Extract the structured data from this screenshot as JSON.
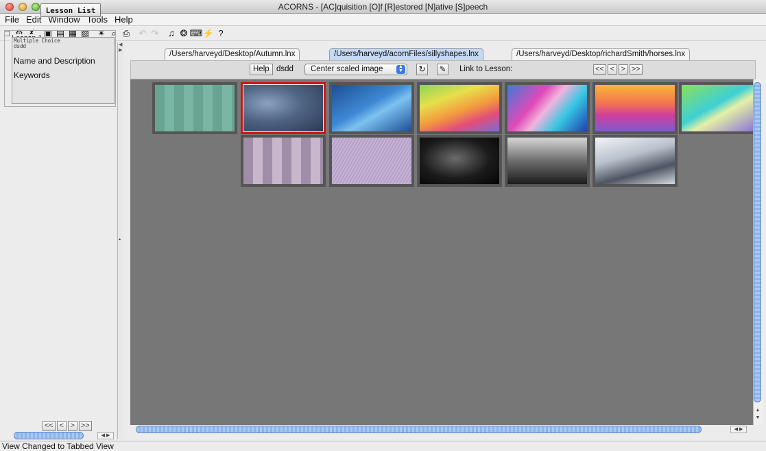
{
  "window": {
    "title": "ACORNS - [AC]quisition [O]f [R]estored [N]ative [S]peech"
  },
  "menu": [
    "File",
    "Edit",
    "Window",
    "Tools",
    "Help"
  ],
  "toolbar": [
    {
      "icon": "new-page-icon",
      "glyph": "□"
    },
    {
      "icon": "open-icon",
      "glyph": "⚙"
    },
    {
      "icon": "cut-icon",
      "glyph": "✗"
    },
    {
      "icon": "save-icon",
      "glyph": "▣"
    },
    {
      "icon": "import-icon",
      "glyph": "▤"
    },
    {
      "icon": "book-icon",
      "glyph": "▦"
    },
    {
      "icon": "book-edit-icon",
      "glyph": "▧"
    },
    {
      "icon": "sparkle-icon",
      "glyph": "✴"
    },
    {
      "icon": "magnify-icon",
      "glyph": "⌕"
    },
    {
      "icon": "print-icon",
      "glyph": "⎙"
    },
    {
      "icon": "undo-icon",
      "glyph": "↶",
      "dim": true
    },
    {
      "icon": "redo-icon",
      "glyph": "↷",
      "dim": true
    },
    {
      "icon": "speaker-icon",
      "glyph": "♫"
    },
    {
      "icon": "lightbulb-icon",
      "glyph": "❂"
    },
    {
      "icon": "keyboard-icon",
      "glyph": "⌨"
    },
    {
      "icon": "lightning-icon",
      "glyph": "⚡"
    },
    {
      "icon": "help-icon",
      "glyph": "?"
    }
  ],
  "left_panel": {
    "lesson_list_label": "Lesson List",
    "lesson_title": "Lesson 1",
    "lesson_type_line1": "Multiple Choice",
    "lesson_type_line2": "dsdd",
    "name_description": "Name and Description",
    "keywords": "Keywords",
    "nav": [
      "<<",
      "<",
      ">",
      ">>"
    ]
  },
  "tabs": [
    {
      "label": "/Users/harveyd/Desktop/Autumn.lnx",
      "active": false
    },
    {
      "label": "/Users/harveyd/acornFiles/sillyshapes.lnx",
      "active": true
    },
    {
      "label": "/Users/harveyd/Desktop/richardSmith/horses.lnx",
      "active": false
    }
  ],
  "content_header": {
    "help_label": "Help",
    "lesson_name": "dsdd",
    "scale_option": "Center scaled image",
    "link_label": "Link to Lesson:",
    "nav": [
      "<<",
      "<",
      ">",
      ">>"
    ]
  },
  "thumbnails": [
    {
      "name": "teal-squares",
      "selected": false
    },
    {
      "name": "blue-gray-swirl",
      "selected": true
    },
    {
      "name": "blue-wave",
      "selected": false
    },
    {
      "name": "rainbow-diagonal",
      "selected": false
    },
    {
      "name": "pink-cyan-ribbon",
      "selected": false
    },
    {
      "name": "sunset-waves",
      "selected": false
    },
    {
      "name": "cyan-green-gradient",
      "selected": false
    },
    {
      "name": "purple-squares",
      "selected": false
    },
    {
      "name": "lavender-lines",
      "selected": false
    },
    {
      "name": "lightning-storm",
      "selected": false
    },
    {
      "name": "bw-pier",
      "selected": false
    },
    {
      "name": "silver-dune",
      "selected": false
    }
  ],
  "status": "View Changed to Tabbed View"
}
